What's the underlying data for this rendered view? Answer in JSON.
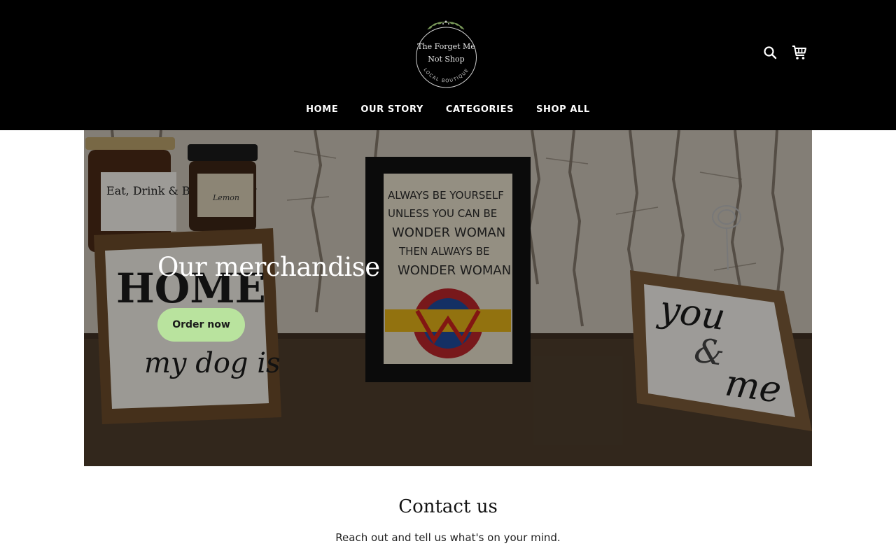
{
  "header": {
    "logo": {
      "line1": "The Forget Me",
      "line2": "Not Shop",
      "ring_text": "LOCAL BOUTIQUE"
    },
    "icons": {
      "search": "search-icon",
      "cart": "cart-icon"
    },
    "nav": [
      {
        "label": "HOME"
      },
      {
        "label": "OUR STORY"
      },
      {
        "label": "CATEGORIES"
      },
      {
        "label": "SHOP ALL"
      }
    ]
  },
  "hero": {
    "title": "Our merchandise",
    "button_label": "Order now",
    "photo_text": {
      "jar1": "Eat, Drink & Be Rosemary",
      "jar2": "Lemon",
      "sign1_top": "HOME",
      "sign1_bottom": "my dog is",
      "frame": [
        "ALWAYS BE YOURSELF",
        "UNLESS YOU CAN BE",
        "WONDER WOMAN",
        "THEN ALWAYS BE",
        "WONDER WOMAN"
      ],
      "sign2": [
        "you",
        "&",
        "me"
      ]
    }
  },
  "contact": {
    "title": "Contact us",
    "subtitle": "Reach out and tell us what's on your mind."
  },
  "colors": {
    "header_bg": "#000000",
    "button_bg": "#b9e39e",
    "page_bg": "#ffffff"
  }
}
